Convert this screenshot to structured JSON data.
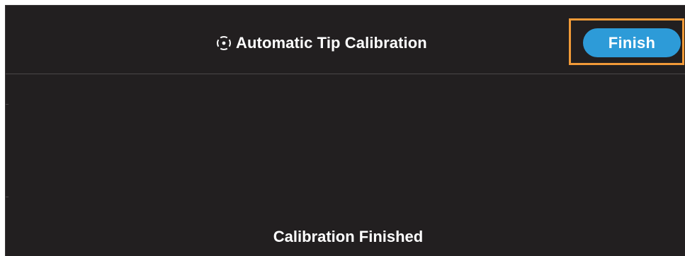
{
  "header": {
    "title": "Automatic Tip Calibration",
    "title_icon": "target-crosshair-icon",
    "finish_label": "Finish"
  },
  "content": {
    "status_text": "Calibration Finished"
  },
  "colors": {
    "background": "#221f20",
    "accent_button": "#2d9bd8",
    "highlight": "#f19a38",
    "text": "#ffffff"
  }
}
